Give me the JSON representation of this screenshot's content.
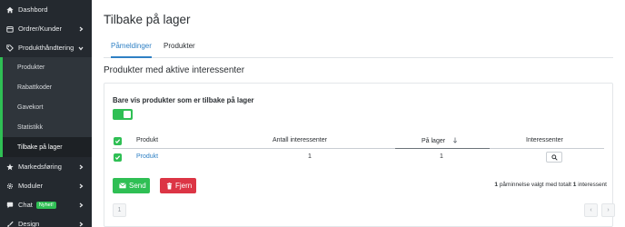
{
  "sidebar": {
    "items": [
      {
        "label": "Dashbord",
        "icon": "home-icon"
      },
      {
        "label": "Ordrer/Kunder",
        "icon": "cart-icon"
      },
      {
        "label": "Produkthåndtering",
        "icon": "tag-icon"
      }
    ],
    "submenu": [
      {
        "label": "Produkter"
      },
      {
        "label": "Rabattkoder"
      },
      {
        "label": "Gavekort"
      },
      {
        "label": "Statistikk"
      },
      {
        "label": "Tilbake på lager"
      }
    ],
    "items_after": [
      {
        "label": "Markedsføring",
        "icon": "star-icon"
      },
      {
        "label": "Moduler",
        "icon": "gear-icon"
      },
      {
        "label": "Chat",
        "icon": "chat-icon",
        "badge": "Nyhet!"
      },
      {
        "label": "Design",
        "icon": "brush-icon"
      }
    ]
  },
  "page": {
    "title": "Tilbake på lager",
    "tabs": [
      {
        "label": "Påmeldinger"
      },
      {
        "label": "Produkter"
      }
    ],
    "section_title": "Produkter med aktive interessenter"
  },
  "filter": {
    "label": "Bare vis produkter som er tilbake på lager",
    "enabled": true
  },
  "table": {
    "headers": [
      "Produkt",
      "Antall interessenter",
      "På lager",
      "Interessenter"
    ],
    "rows": [
      {
        "product": "Produkt",
        "count": "1",
        "stock": "1"
      }
    ]
  },
  "actions": {
    "send_label": "Send",
    "remove_label": "Fjern"
  },
  "summary": {
    "count": "1",
    "text_a": " påminnelse valgt med totalt ",
    "total": "1",
    "text_b": " interessent"
  },
  "pagination": {
    "current": "1",
    "prev": "‹",
    "next": "›"
  },
  "colors": {
    "accent": "#2fbf54",
    "link": "#2f80c4",
    "danger": "#dc3545",
    "sidebar": "#24292f"
  }
}
